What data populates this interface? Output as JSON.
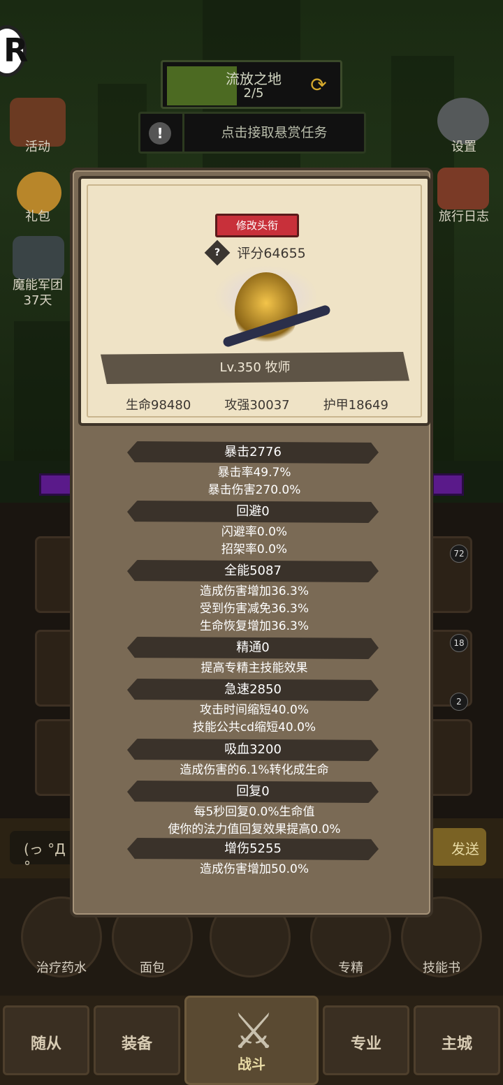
{
  "hud": {
    "r_badge": "R",
    "level_title": "流放之地",
    "level_progress": "2/5",
    "bounty_text": "点击接取悬赏任务",
    "bounty_icon": "!",
    "refresh_icon": "⟳",
    "left_icons": [
      {
        "label": "活动",
        "icon": "event-icon"
      },
      {
        "label": "礼包",
        "icon": "gift-icon"
      },
      {
        "label": "魔能军团\n37天",
        "icon": "legion-icon"
      }
    ],
    "right_icons": [
      {
        "label": "设置",
        "icon": "gear-icon"
      },
      {
        "label": "旅行日志",
        "icon": "journal-icon"
      }
    ]
  },
  "modal": {
    "title_button": "修改头衔",
    "score": "评分64655",
    "help_icon": "?",
    "level_class": "Lv.350 牧师",
    "stats": {
      "hp": "生命98480",
      "attack": "攻强30037",
      "armor": "护甲18649"
    },
    "groups": [
      {
        "header": "暴击2776",
        "lines": [
          "暴击率49.7%",
          "暴击伤害270.0%"
        ]
      },
      {
        "header": "回避0",
        "lines": [
          "闪避率0.0%",
          "招架率0.0%"
        ]
      },
      {
        "header": "全能5087",
        "lines": [
          "造成伤害增加36.3%",
          "受到伤害减免36.3%",
          "生命恢复增加36.3%"
        ]
      },
      {
        "header": "精通0",
        "lines": [
          "提高专精主技能效果"
        ]
      },
      {
        "header": "急速2850",
        "lines": [
          "攻击时间缩短40.0%",
          "技能公共cd缩短40.0%"
        ]
      },
      {
        "header": "吸血3200",
        "lines": [
          "造成伤害的6.1%转化成生命"
        ]
      },
      {
        "header": "回复0",
        "lines": [
          "每5秒回复0.0%生命值",
          "使你的法力值回复效果提高0.0%"
        ]
      },
      {
        "header": "增伤5255",
        "lines": [
          "造成伤害增加50.0%"
        ]
      }
    ]
  },
  "slots": {
    "badge_1": "72",
    "badge_2": "18",
    "badge_3": "2"
  },
  "chat": {
    "input_text": "(っ °Д °",
    "send_label": "发送"
  },
  "items": [
    {
      "label": "治疗药水",
      "icon": "potion-icon"
    },
    {
      "label": "面包",
      "icon": "bread-icon"
    },
    {
      "label": "",
      "icon": "chest-icon"
    },
    {
      "label": "专精",
      "icon": "spec-icon"
    },
    {
      "label": "技能书",
      "icon": "skillbook-icon"
    }
  ],
  "nav": {
    "followers": "随从",
    "equipment": "装备",
    "battle": "战斗",
    "profession": "专业",
    "main_city": "主城",
    "battle_icon": "crossed-swords-icon"
  },
  "colors": {
    "modal_bg": "#7a6a55",
    "card_bg": "#efe3c6",
    "title_button": "#c8303a",
    "stat_header": "#3a322a"
  }
}
